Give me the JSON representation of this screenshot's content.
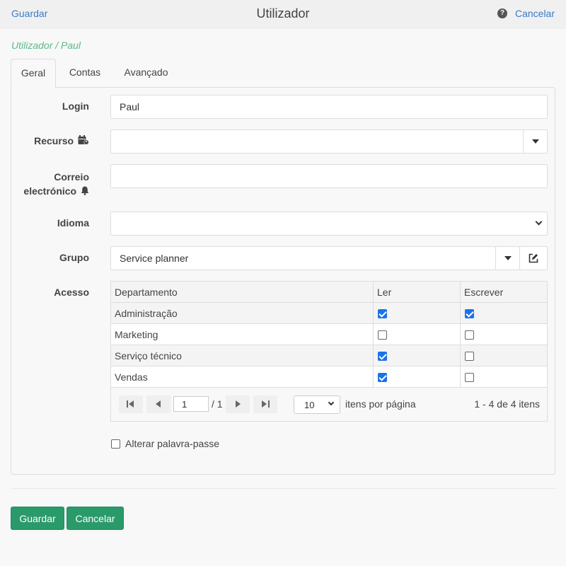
{
  "header": {
    "save_link": "Guardar",
    "title": "Utilizador",
    "cancel_link": "Cancelar"
  },
  "breadcrumb": "Utilizador / Paul",
  "tabs": [
    {
      "label": "Geral",
      "active": true
    },
    {
      "label": "Contas",
      "active": false
    },
    {
      "label": "Avançado",
      "active": false
    }
  ],
  "form": {
    "login": {
      "label": "Login",
      "value": "Paul"
    },
    "resource": {
      "label": "Recurso",
      "value": "",
      "icon": "calendar-user-icon"
    },
    "email": {
      "label_line1": "Correio",
      "label_line2": "electrónico",
      "value": "",
      "icon": "bell-icon"
    },
    "language": {
      "label": "Idioma",
      "value": ""
    },
    "group": {
      "label": "Grupo",
      "value": "Service planner"
    },
    "access": {
      "label": "Acesso"
    }
  },
  "access_table": {
    "columns": [
      "Departamento",
      "Ler",
      "Escrever"
    ],
    "rows": [
      {
        "department": "Administração",
        "read": true,
        "write": true
      },
      {
        "department": "Marketing",
        "read": false,
        "write": false
      },
      {
        "department": "Serviço técnico",
        "read": true,
        "write": false
      },
      {
        "department": "Vendas",
        "read": true,
        "write": false
      }
    ]
  },
  "pager": {
    "page": "1",
    "total_pages": "/ 1",
    "page_size": "10",
    "per_page_label": "itens por página",
    "info": "1 - 4 de 4 itens"
  },
  "change_password": {
    "label": "Alterar palavra-passe",
    "checked": false
  },
  "footer": {
    "save_label": "Guardar",
    "cancel_label": "Cancelar"
  },
  "colors": {
    "link": "#3a7bc8",
    "breadcrumb": "#5cb88a",
    "primary_button": "#2a9a6b",
    "checkbox_on": "#1a73e8"
  }
}
